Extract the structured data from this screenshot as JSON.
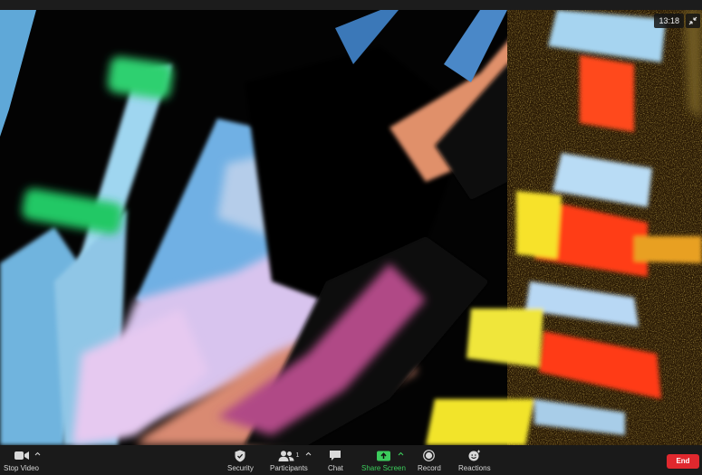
{
  "meeting": {
    "elapsed_time": "13:18"
  },
  "toolbar": {
    "stop_video_label": "Stop Video",
    "security_label": "Security",
    "participants_label": "Participants",
    "participants_count": "1",
    "chat_label": "Chat",
    "share_screen_label": "Share Screen",
    "record_label": "Record",
    "reactions_label": "Reactions",
    "end_label": "End"
  },
  "icons": {
    "video": "video-camera-icon",
    "security": "shield-icon",
    "participants": "people-icon",
    "chat": "chat-bubble-icon",
    "share": "share-screen-icon",
    "record": "record-icon",
    "reactions": "smiley-icon",
    "exit_fullscreen": "exit-fullscreen-icon",
    "caret": "chevron-up-icon"
  },
  "colors": {
    "share_accent": "#3ccc5c",
    "end_button": "#e0282e",
    "toolbar_bg": "#1a1a1a"
  }
}
